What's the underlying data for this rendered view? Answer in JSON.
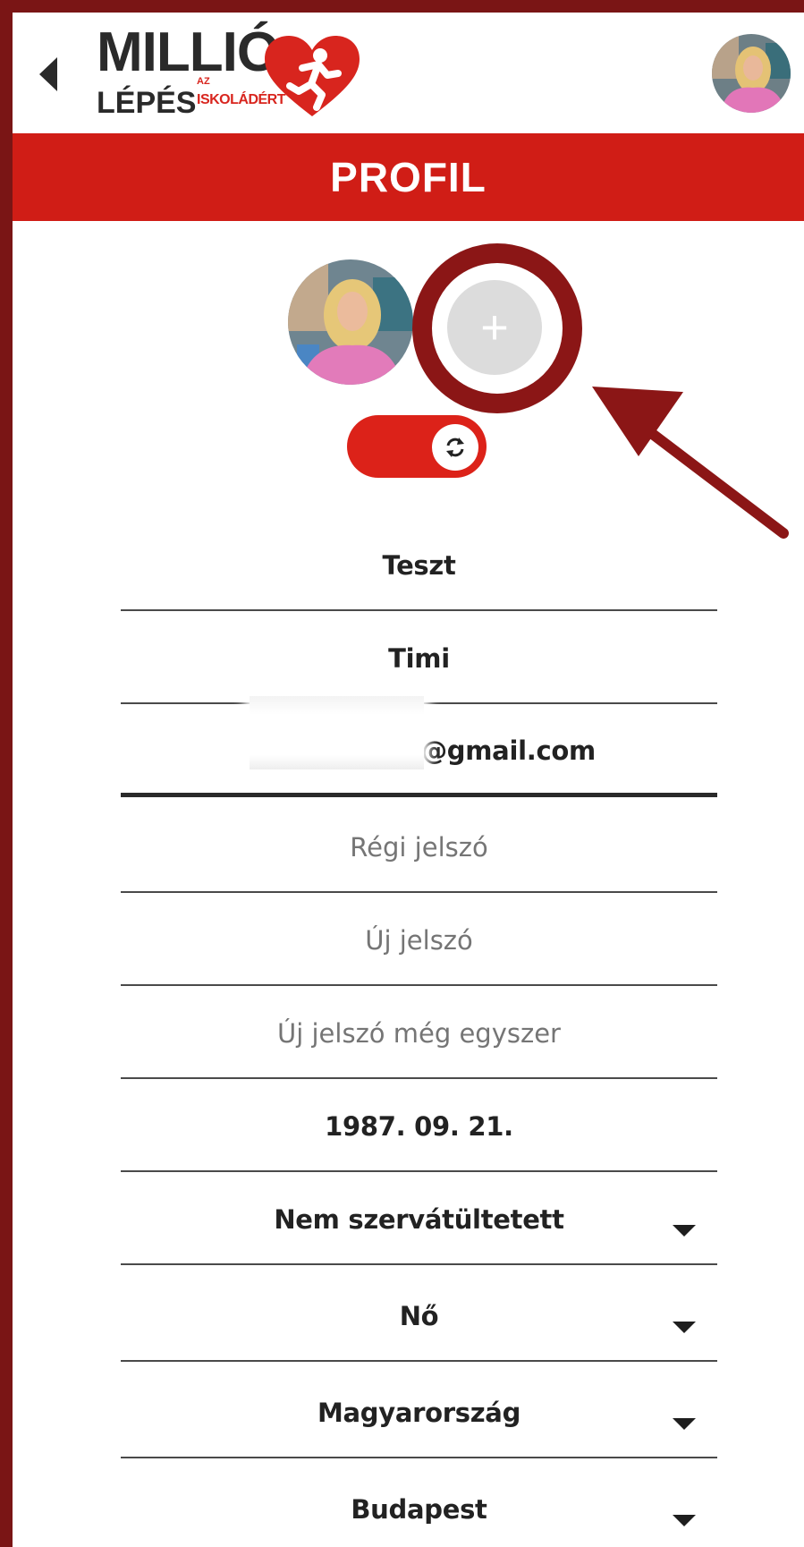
{
  "header": {
    "logo_top": "MILLIÓ",
    "logo_bottom": "LÉPÉS",
    "logo_az": "AZ",
    "logo_sub": "ISKOLÁDÉRT",
    "back_icon": "back-triangle-icon",
    "avatar_icon": "user-avatar"
  },
  "title_bar": {
    "title": "PROFIL"
  },
  "profile": {
    "add_photo_symbol": "+",
    "toggle_icon": "sync-icon"
  },
  "form": {
    "last_name": "Teszt",
    "first_name": "Timi",
    "email": "@gmail.com",
    "old_password_placeholder": "Régi jelszó",
    "new_password_placeholder": "Új jelszó",
    "new_password_again_placeholder": "Új jelszó még egyszer",
    "birth_date": "1987. 09. 21.",
    "transplant_status": "Nem szervátültetett",
    "gender": "Nő",
    "country": "Magyarország",
    "city": "Budapest"
  },
  "colors": {
    "brand_red": "#d01d16",
    "frame": "#7a1515",
    "highlight": "#8b1616"
  }
}
